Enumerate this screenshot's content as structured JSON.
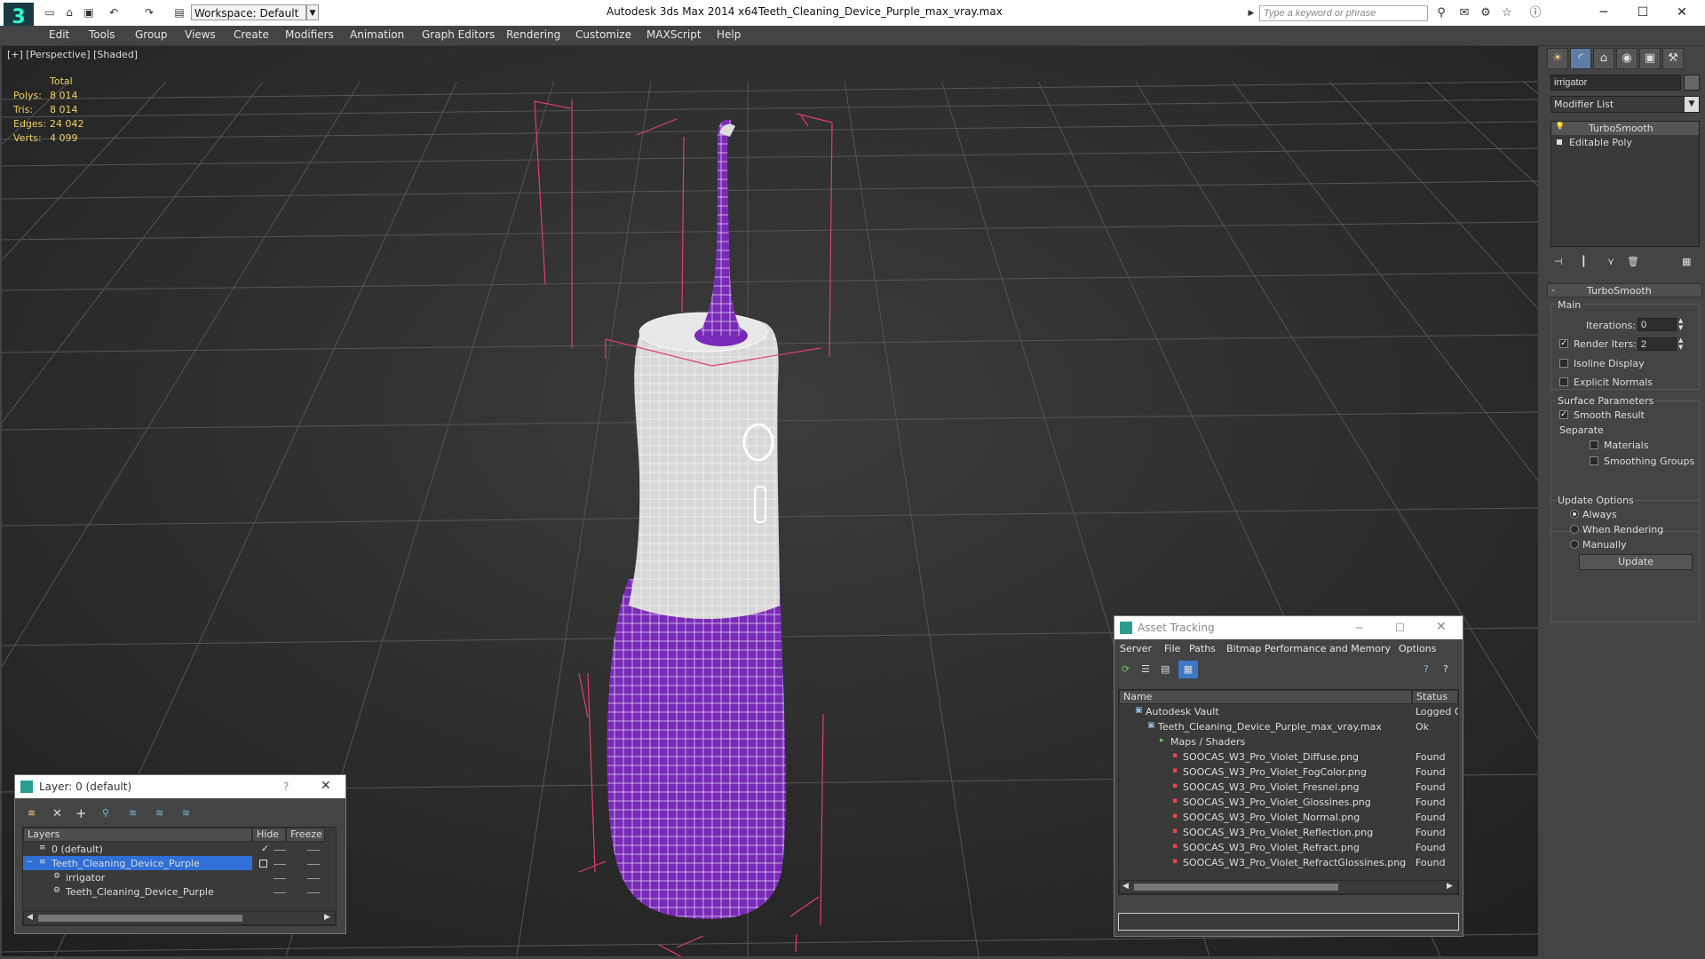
{
  "titlebar": {
    "app_title": "Autodesk 3ds Max  2014 x64",
    "file_title": "Teeth_Cleaning_Device_Purple_max_vray.max",
    "workspace": "Workspace: Default",
    "search_placeholder": "Type a keyword or phrase"
  },
  "menu": [
    "Edit",
    "Tools",
    "Group",
    "Views",
    "Create",
    "Modifiers",
    "Animation",
    "Graph Editors",
    "Rendering",
    "Customize",
    "MAXScript",
    "Help"
  ],
  "viewport": {
    "label": "[+] [Perspective] [Shaded]",
    "stats": {
      "header": "Total",
      "rows": [
        {
          "label": "Polys:",
          "value": "8 014"
        },
        {
          "label": "Tris:",
          "value": "8 014"
        },
        {
          "label": "Edges:",
          "value": "24 042"
        },
        {
          "label": "Verts:",
          "value": "4 099"
        }
      ]
    },
    "colors": {
      "body": "#7a2ab8",
      "wire": "#ffffff",
      "shell": "#d8d8d8",
      "grid": "#555555",
      "bbox": "#e0406a"
    }
  },
  "command_panel": {
    "object_name": "irrigator",
    "modifier_list": "Modifier List",
    "stack": [
      "TurboSmooth",
      "Editable Poly"
    ],
    "rollout_title": "TurboSmooth",
    "main_label": "Main",
    "iterations_label": "Iterations:",
    "iterations_value": "0",
    "render_iters_label": "Render Iters:",
    "render_iters_value": "2",
    "isoline_label": "Isoline Display",
    "explicit_normals_label": "Explicit Normals",
    "surface_params_label": "Surface Parameters",
    "smooth_result_label": "Smooth Result",
    "separate_label": "Separate",
    "materials_label": "Materials",
    "smoothing_groups_label": "Smoothing Groups",
    "update_options_label": "Update Options",
    "always_label": "Always",
    "when_rendering_label": "When Rendering",
    "manually_label": "Manually",
    "update_button": "Update"
  },
  "layer_dialog": {
    "title": "Layer: 0 (default)",
    "help": "?",
    "columns": [
      "Layers",
      "Hide",
      "Freeze"
    ],
    "rows": [
      {
        "name": "0 (default)",
        "indent": 0
      },
      {
        "name": "Teeth_Cleaning_Device_Purple",
        "indent": 0
      },
      {
        "name": "irrigator",
        "indent": 1
      },
      {
        "name": "Teeth_Cleaning_Device_Purple",
        "indent": 1
      }
    ]
  },
  "asset_dialog": {
    "title": "Asset Tracking",
    "menu": [
      "Server",
      "File",
      "Paths",
      "Bitmap Performance and Memory",
      "Options"
    ],
    "columns": [
      "Name",
      "Status"
    ],
    "rows": [
      {
        "name": "Autodesk Vault",
        "status": "Logged O",
        "indent": 0
      },
      {
        "name": "Teeth_Cleaning_Device_Purple_max_vray.max",
        "status": "Ok",
        "indent": 1
      },
      {
        "name": "Maps / Shaders",
        "status": "",
        "indent": 2
      },
      {
        "name": "SOOCAS_W3_Pro_Violet_Diffuse.png",
        "status": "Found",
        "indent": 3
      },
      {
        "name": "SOOCAS_W3_Pro_Violet_FogColor.png",
        "status": "Found",
        "indent": 3
      },
      {
        "name": "SOOCAS_W3_Pro_Violet_Fresnel.png",
        "status": "Found",
        "indent": 3
      },
      {
        "name": "SOOCAS_W3_Pro_Violet_Glossines.png",
        "status": "Found",
        "indent": 3
      },
      {
        "name": "SOOCAS_W3_Pro_Violet_Normal.png",
        "status": "Found",
        "indent": 3
      },
      {
        "name": "SOOCAS_W3_Pro_Violet_Reflection.png",
        "status": "Found",
        "indent": 3
      },
      {
        "name": "SOOCAS_W3_Pro_Violet_Refract.png",
        "status": "Found",
        "indent": 3
      },
      {
        "name": "SOOCAS_W3_Pro_Violet_RefractGlossines.png",
        "status": "Found",
        "indent": 3
      }
    ]
  }
}
